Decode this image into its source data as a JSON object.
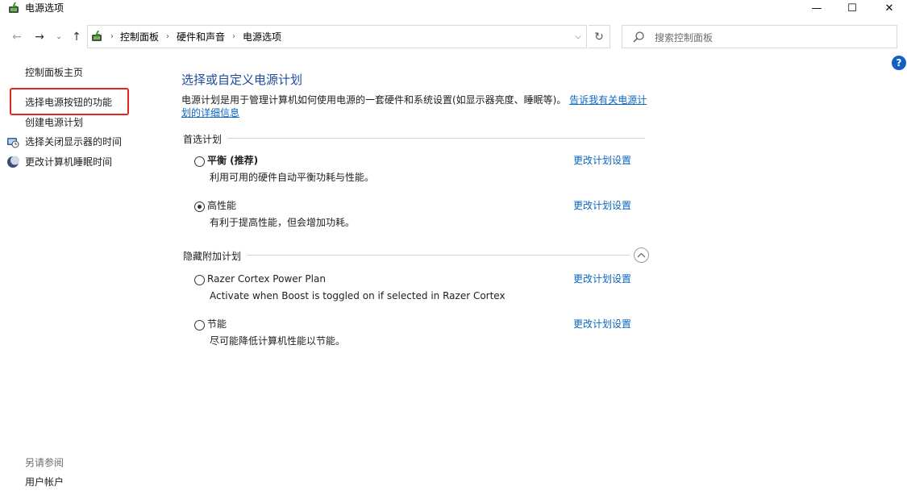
{
  "window": {
    "title": "电源选项",
    "minimize": "—",
    "maximize": "☐",
    "close": "✕"
  },
  "nav": {
    "back": "←",
    "forward": "→",
    "recent": "⌄",
    "up": "↑",
    "refresh": "↻",
    "breadcrumbs": [
      "控制面板",
      "硬件和声音",
      "电源选项"
    ],
    "search_placeholder": "搜索控制面板"
  },
  "sidebar": {
    "home": "控制面板主页",
    "items": [
      {
        "label": "选择电源按钮的功能",
        "icon": "none"
      },
      {
        "label": "创建电源计划",
        "icon": "none"
      },
      {
        "label": "选择关闭显示器的时间",
        "icon": "display-clock-icon"
      },
      {
        "label": "更改计算机睡眠时间",
        "icon": "moon-icon"
      }
    ],
    "see_also": "另请参阅",
    "user_accounts": "用户帐户"
  },
  "main": {
    "title": "选择或自定义电源计划",
    "description": "电源计划是用于管理计算机如何使用电源的一套硬件和系统设置(如显示器亮度、睡眠等)。",
    "description_link": "告诉我有关电源计划的详细信息",
    "preferred_header": "首选计划",
    "hidden_header": "隐藏附加计划",
    "change_settings": "更改计划设置",
    "plans": [
      {
        "name": "平衡 (推荐)",
        "desc": "利用可用的硬件自动平衡功耗与性能。",
        "selected": false
      },
      {
        "name": "高性能",
        "desc": "有利于提高性能，但会增加功耗。",
        "selected": true
      },
      {
        "name": "Razer Cortex Power Plan",
        "desc": "Activate when Boost is toggled on if selected in Razer Cortex",
        "selected": false
      },
      {
        "name": "节能",
        "desc": "尽可能降低计算机性能以节能。",
        "selected": false
      }
    ]
  },
  "colors": {
    "accent_title": "#1e4b9c",
    "link": "#0b66c2",
    "highlight": "#e0261f",
    "help": "#1160c2"
  }
}
